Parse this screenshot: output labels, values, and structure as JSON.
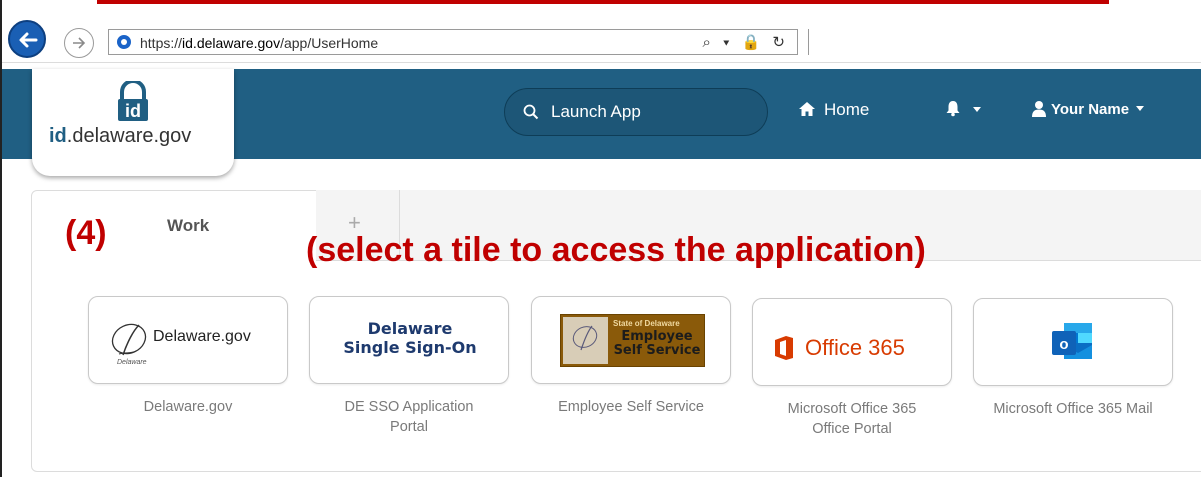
{
  "browser": {
    "url_scheme": "https://",
    "url_host": "id.delaware.gov",
    "url_path": "/app/UserHome",
    "address_icons": "⌕ ▾ 🔒 ↻"
  },
  "navbar": {
    "logo_brand": "id",
    "logo_rest": ".delaware.gov",
    "launch_label": "Launch App",
    "home_label": "Home",
    "user_label": "Your Name"
  },
  "tabs": {
    "work": "Work",
    "add": "+"
  },
  "annotations": {
    "number": "(4)",
    "instruction": "(select a tile to access the application)"
  },
  "tiles": [
    {
      "logo_text": "Delaware.gov",
      "logo_sub": "Delaware",
      "label_line1": "Delaware.gov",
      "label_line2": ""
    },
    {
      "logo_line1": "Delaware",
      "logo_line2": "Single Sign-On",
      "label_line1": "DE SSO Application",
      "label_line2": "Portal"
    },
    {
      "logo_small": "State of Delaware",
      "logo_line1": "Employee",
      "logo_line2": "Self Service",
      "label_line1": "Employee Self Service",
      "label_line2": ""
    },
    {
      "logo_text": "Office 365",
      "label_line1": "Microsoft Office 365",
      "label_line2": "Office Portal"
    },
    {
      "logo_text": "",
      "label_line1": "Microsoft Office 365 Mail",
      "label_line2": ""
    }
  ],
  "colors": {
    "navbar": "#205f83",
    "annotation_red": "#c00000",
    "office_orange": "#d83b01"
  }
}
